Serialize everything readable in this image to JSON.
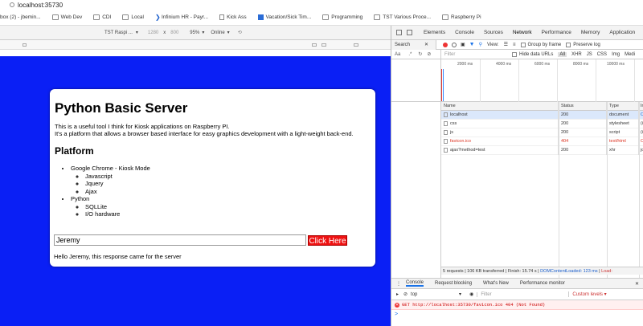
{
  "browser": {
    "url": "localhost:35730",
    "bookmarks": [
      {
        "label": "box (2) - jbemin...",
        "icon": "folder"
      },
      {
        "label": "Web Dev",
        "icon": "folder"
      },
      {
        "label": "CDI",
        "icon": "folder"
      },
      {
        "label": "Local",
        "icon": "folder"
      },
      {
        "label": "Infinium HR - Payr...",
        "icon": "chevron"
      },
      {
        "label": "Kick Ass",
        "icon": "page"
      },
      {
        "label": "Vacation/Sick Tim...",
        "icon": "blue-square"
      },
      {
        "label": "Programming",
        "icon": "folder"
      },
      {
        "label": "TST Various Proce...",
        "icon": "folder"
      },
      {
        "label": "Raspberry Pi",
        "icon": "folder"
      }
    ]
  },
  "device_toolbar": {
    "device": "TST Raspi ...",
    "width": "1280",
    "times": "x",
    "height": "800",
    "zoom": "95%",
    "network": "Online"
  },
  "page": {
    "title": "Python Basic Server",
    "intro1": "This is a useful tool I think for Kiosk applications on Raspberry PI.",
    "intro2": "It's a platform that allows a browser based interface for easy graphics development with a light-weight back-end.",
    "platform_heading": "Platform",
    "list": {
      "chrome": "Google Chrome - Kiosk Mode",
      "chrome_items": [
        "Javascript",
        "Jquery",
        "Ajax"
      ],
      "python": "Python",
      "python_items": [
        "SQLLite",
        "I/O hardware"
      ]
    },
    "name_value": "Jeremy",
    "button_label": "Click Here",
    "response": "Hello Jeremy, this response came for the server"
  },
  "devtools": {
    "tabs": [
      "Elements",
      "Console",
      "Sources",
      "Network",
      "Performance",
      "Memory",
      "Application"
    ],
    "active_tab": "Network",
    "search_label": "Search",
    "view_label": "View:",
    "group_by_frame": "Group by frame",
    "preserve_log": "Preserve log",
    "aa": "Aa",
    "filter_placeholder": "Filter",
    "hide_data_urls": "Hide data URLs",
    "filter_types": [
      "All",
      "XHR",
      "JS",
      "CSS",
      "Img",
      "Medi"
    ],
    "timeline_ticks": [
      "2000 ms",
      "4000 ms",
      "6000 ms",
      "8000 ms",
      "10000 ms"
    ],
    "table": {
      "headers": [
        "Name",
        "Status",
        "Type",
        "Ir"
      ],
      "rows": [
        {
          "name": "localhost",
          "status": "200",
          "type": "document",
          "init": "O"
        },
        {
          "name": "css",
          "status": "200",
          "type": "stylesheet",
          "init": "(i"
        },
        {
          "name": "js",
          "status": "200",
          "type": "script",
          "init": "(i"
        },
        {
          "name": "favicon.ico",
          "status": "404",
          "type": "text/html",
          "init": "O"
        },
        {
          "name": "ajax?method=test",
          "status": "200",
          "type": "xhr",
          "init": "jq"
        }
      ]
    },
    "summary": {
      "text": "5 requests | 106 KB transferred | Finish: 15.74 s | ",
      "dom": "DOMContentLoaded: 123 ms",
      "sep": " | ",
      "load": "Load: "
    },
    "drawer_tabs": [
      "Console",
      "Request blocking",
      "What's New",
      "Performance monitor"
    ],
    "console": {
      "context": "top",
      "filter_placeholder": "Filter",
      "levels": "Custom levels ▾",
      "error": "GET http://localhost:35730/favicon.ico 404 (Not Found)",
      "prompt": ">"
    }
  }
}
